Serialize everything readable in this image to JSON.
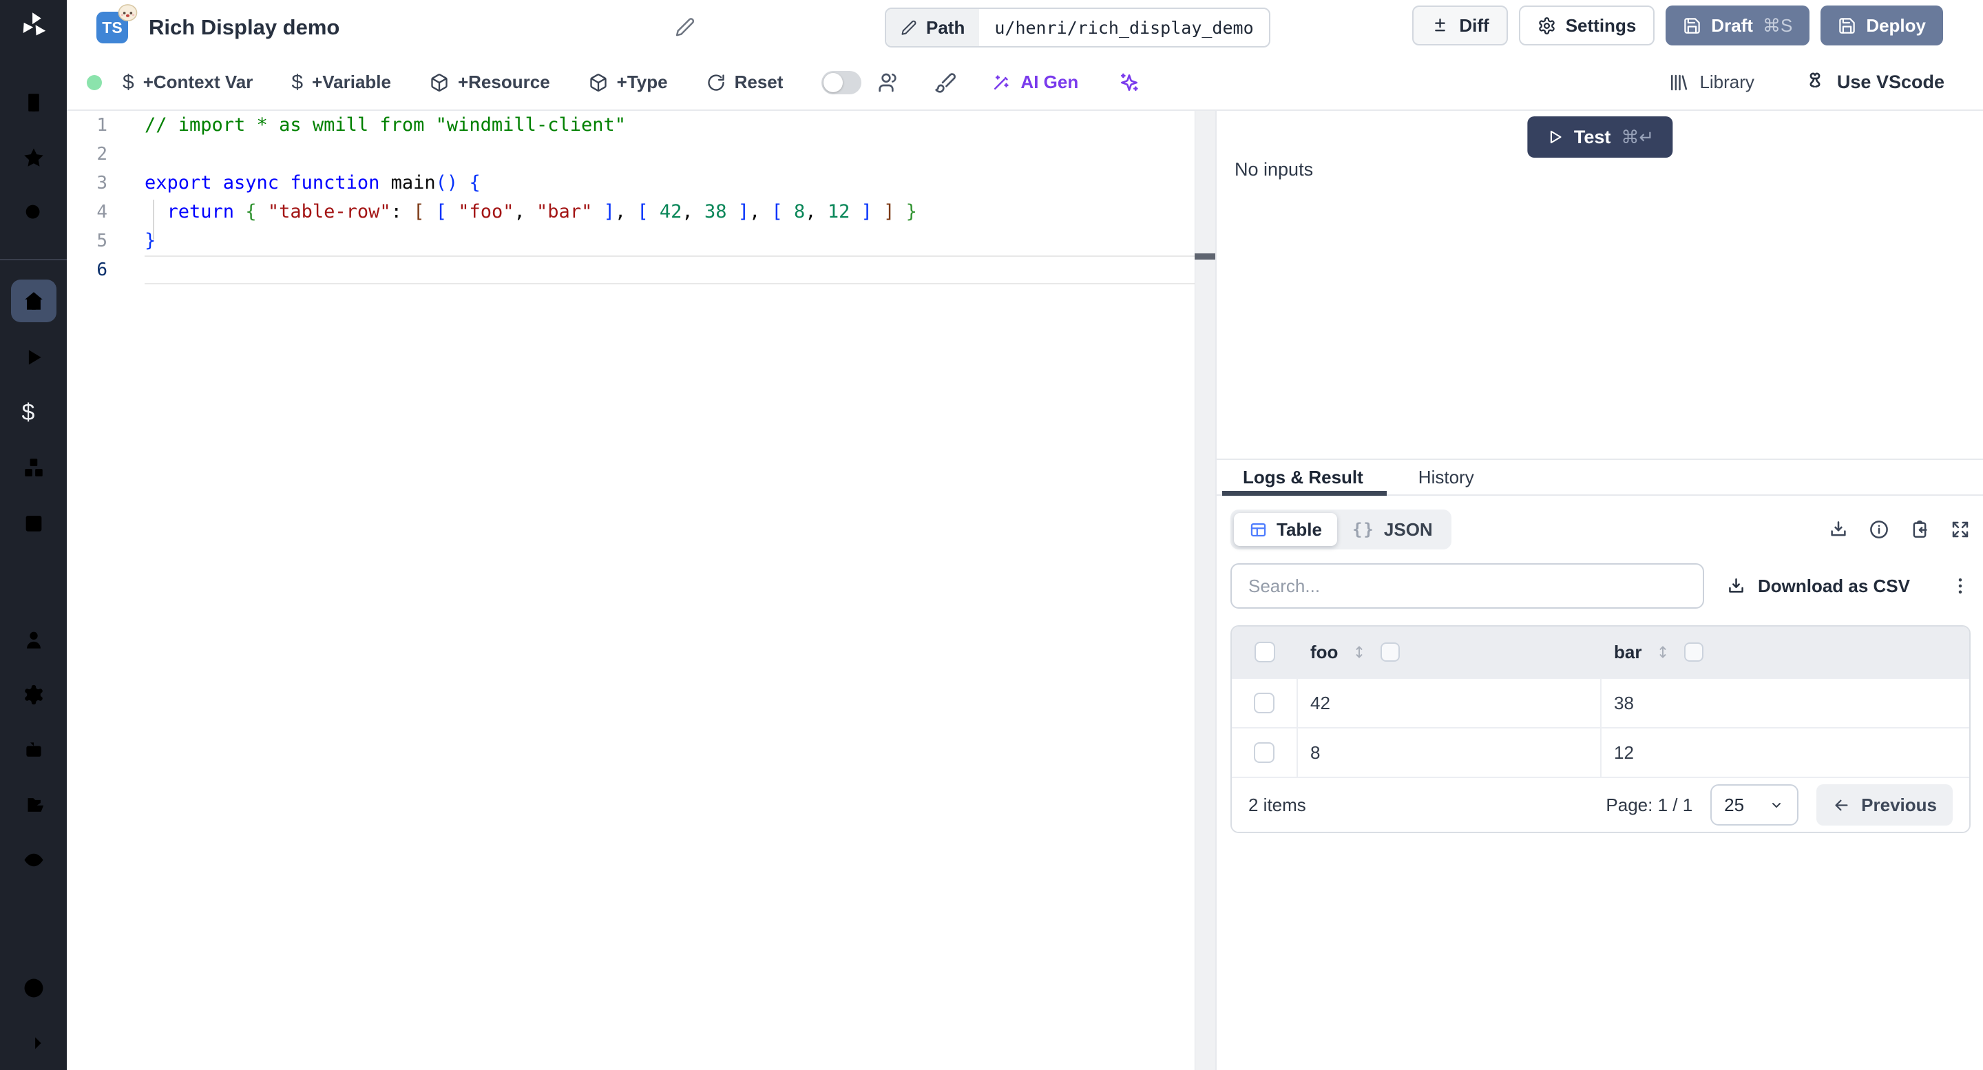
{
  "header": {
    "badge": "TS",
    "title": "Rich Display demo",
    "path_label": "Path",
    "path_value": "u/henri/rich_display_demo",
    "diff_label": "Diff",
    "settings_label": "Settings",
    "draft_label": "Draft",
    "draft_shortcut": "⌘S",
    "deploy_label": "Deploy"
  },
  "toolbar": {
    "dollar": "$",
    "context_var": "+Context Var",
    "variable": "+Variable",
    "resource": "+Resource",
    "type": "+Type",
    "reset": "Reset",
    "ai_gen": "AI Gen",
    "library": "Library",
    "use_vscode": "Use VScode"
  },
  "editor": {
    "lines": [
      {
        "n": "1",
        "tokens": [
          [
            "c",
            "// import * as wmill from \"windmill-client\""
          ]
        ]
      },
      {
        "n": "2",
        "tokens": []
      },
      {
        "n": "3",
        "tokens": [
          [
            "k",
            "export async function "
          ],
          [
            "p",
            "main"
          ],
          [
            "b1",
            "("
          ],
          [
            "b1",
            ")"
          ],
          [
            "p",
            " "
          ],
          [
            "b1",
            "{"
          ]
        ]
      },
      {
        "n": "4",
        "tokens": [
          [
            "p",
            "  "
          ],
          [
            "k",
            "return"
          ],
          [
            "p",
            " "
          ],
          [
            "b2",
            "{"
          ],
          [
            "p",
            " "
          ],
          [
            "s",
            "\"table-row\""
          ],
          [
            "p",
            ": "
          ],
          [
            "b3",
            "["
          ],
          [
            "p",
            " "
          ],
          [
            "b1",
            "["
          ],
          [
            "p",
            " "
          ],
          [
            "s",
            "\"foo\""
          ],
          [
            "p",
            ", "
          ],
          [
            "s",
            "\"bar\""
          ],
          [
            "p",
            " "
          ],
          [
            "b1",
            "]"
          ],
          [
            "p",
            ", "
          ],
          [
            "b1",
            "["
          ],
          [
            "p",
            " "
          ],
          [
            "n",
            "42"
          ],
          [
            "p",
            ", "
          ],
          [
            "n",
            "38"
          ],
          [
            "p",
            " "
          ],
          [
            "b1",
            "]"
          ],
          [
            "p",
            ", "
          ],
          [
            "b1",
            "["
          ],
          [
            "p",
            " "
          ],
          [
            "n",
            "8"
          ],
          [
            "p",
            ", "
          ],
          [
            "n",
            "12"
          ],
          [
            "p",
            " "
          ],
          [
            "b1",
            "]"
          ],
          [
            "p",
            " "
          ],
          [
            "b3",
            "]"
          ],
          [
            "p",
            " "
          ],
          [
            "b2",
            "}"
          ]
        ]
      },
      {
        "n": "5",
        "tokens": [
          [
            "b1",
            "}"
          ]
        ]
      },
      {
        "n": "6",
        "tokens": [],
        "current": true
      }
    ]
  },
  "run": {
    "test_label": "Test",
    "test_shortcut": "⌘↵",
    "no_inputs": "No inputs"
  },
  "result": {
    "tabs": {
      "logs": "Logs & Result",
      "history": "History"
    },
    "views": {
      "table": "Table",
      "json": "JSON",
      "braces": "{}"
    },
    "search_placeholder": "Search...",
    "download_csv": "Download as CSV",
    "table": {
      "columns": [
        "foo",
        "bar"
      ],
      "rows": [
        [
          "42",
          "38"
        ],
        [
          "8",
          "12"
        ]
      ]
    },
    "footer": {
      "count": "2 items",
      "page": "Page: 1 / 1",
      "page_size": "25",
      "previous": "Previous"
    }
  },
  "colors": {
    "accent_table_icon": "#4d7cfe",
    "ai_purple": "#7a3bec",
    "button_slate": "#697a9b",
    "test_navy": "#36415f",
    "status_green": "#8be3ac",
    "sidebar_bg": "#1e222b"
  }
}
